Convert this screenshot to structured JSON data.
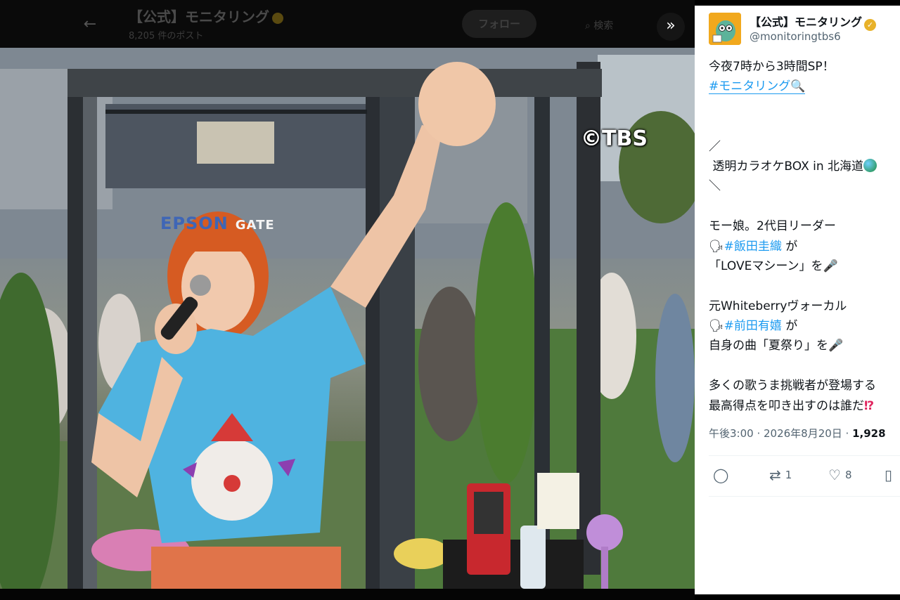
{
  "header": {
    "back_icon": "arrow-left-icon",
    "account_name": "【公式】モニタリング",
    "post_count": "8,205 件のポスト",
    "follow_label": "フォロー",
    "search_label": "検索",
    "expand_icon": "chevron-double-right-icon"
  },
  "media": {
    "watermark": "©TBS",
    "sign_text": "EPSON",
    "sign_text_2": "GATE"
  },
  "tweet": {
    "author_name": "【公式】モニタリング",
    "author_handle": "@monitoringtbs6",
    "lines": [
      "今夜7時から3時間SP！",
      "#モニタリング",
      "／",
      "透明カラオケBOX in 北海道",
      "＼",
      "モー娘。2代目リーダー",
      "#飯田圭織",
      "が",
      "「LOVEマシーン」を",
      "元Whiteberryヴォーカル",
      "#前田有嬉",
      "が",
      "自身の曲「夏祭り」を",
      "多くの歌うま挑戦者が登場する",
      "最高得点を叩き出すのは誰だ"
    ],
    "timestamp": "午後3:00 · 2026年8月20日 · ",
    "views": "1,928",
    "actions": {
      "reply_count": "",
      "retweet_count": "1",
      "like_count": "8"
    }
  },
  "colors": {
    "hashtag": "#1d9bf0",
    "verified": "#e8b22a",
    "text": "#0f1419",
    "muted": "#536471"
  }
}
